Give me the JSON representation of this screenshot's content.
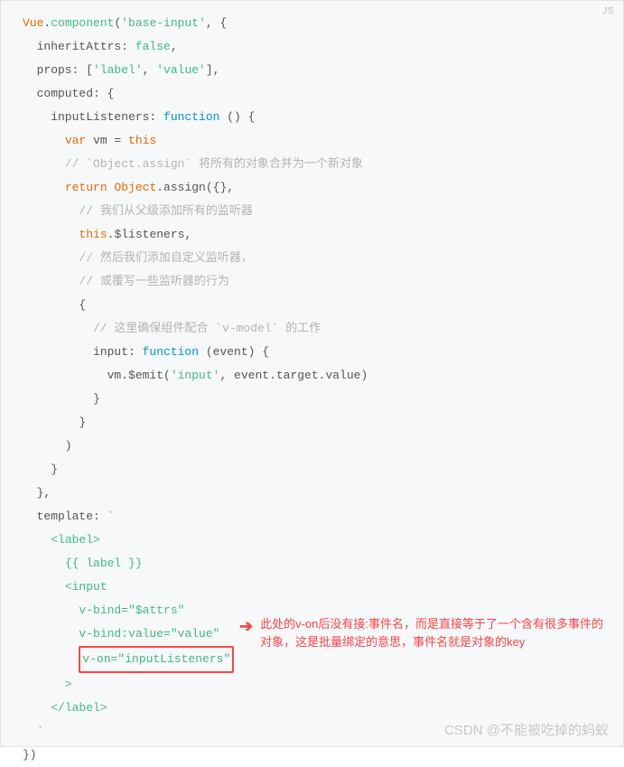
{
  "lang_badge": "JS",
  "code": {
    "l1_a": "Vue",
    "l1_b": ".",
    "l1_c": "component",
    "l1_d": "(",
    "l1_e": "'base-input'",
    "l1_f": ", {",
    "l2_a": "  inheritAttrs: ",
    "l2_b": "false",
    "l2_c": ",",
    "l3_a": "  props: [",
    "l3_b": "'label'",
    "l3_c": ", ",
    "l3_d": "'value'",
    "l3_e": "],",
    "l4": "  computed: {",
    "l5_a": "    inputListeners: ",
    "l5_b": "function",
    "l5_c": " () {",
    "l6_a": "      ",
    "l6_b": "var",
    "l6_c": " vm = ",
    "l6_d": "this",
    "l7_a": "      ",
    "l7_b": "// `Object.assign` 将所有的对象合并为一个新对象",
    "l8_a": "      ",
    "l8_b": "return",
    "l8_c": " ",
    "l8_d": "Object",
    "l8_e": ".assign({},",
    "l9_a": "        ",
    "l9_b": "// 我们从父级添加所有的监听器",
    "l10_a": "        ",
    "l10_b": "this",
    "l10_c": ".$listeners,",
    "l11_a": "        ",
    "l11_b": "// 然后我们添加自定义监听器，",
    "l12_a": "        ",
    "l12_b": "// 或覆写一些监听器的行为",
    "l13": "        {",
    "l14_a": "          ",
    "l14_b": "// 这里确保组件配合 `v-model` 的工作",
    "l15_a": "          input: ",
    "l15_b": "function",
    "l15_c": " (event) {",
    "l16_a": "            vm.$emit(",
    "l16_b": "'input'",
    "l16_c": ", event.target.value)",
    "l17": "          }",
    "l18": "        }",
    "l19": "      )",
    "l20": "    }",
    "l21": "  },",
    "l22_a": "  template: ",
    "l22_b": "`",
    "l23_a": "    ",
    "l23_b": "<label>",
    "l24_a": "      ",
    "l24_b": "{{ label }}",
    "l25_a": "      ",
    "l25_b": "<input",
    "l26_a": "        ",
    "l26_b": "v-bind=\"$attrs\"",
    "l27_a": "        ",
    "l27_b": "v-bind:value=\"value\"",
    "l28_a": "        ",
    "l28_b": "v-on=\"inputListeners\"",
    "l29_a": "      ",
    "l29_b": ">",
    "l30_a": "    ",
    "l30_b": "</label>",
    "l31_a": "  ",
    "l31_b": "`",
    "l32": "})"
  },
  "annotation": {
    "arrow": "➔",
    "text": "此处的v-on后没有接:事件名，而是直接等于了一个含有很多事件的对象，这是批量绑定的意思，事件名就是对象的key"
  },
  "watermark": "CSDN @不能被吃掉的蚂蚁"
}
